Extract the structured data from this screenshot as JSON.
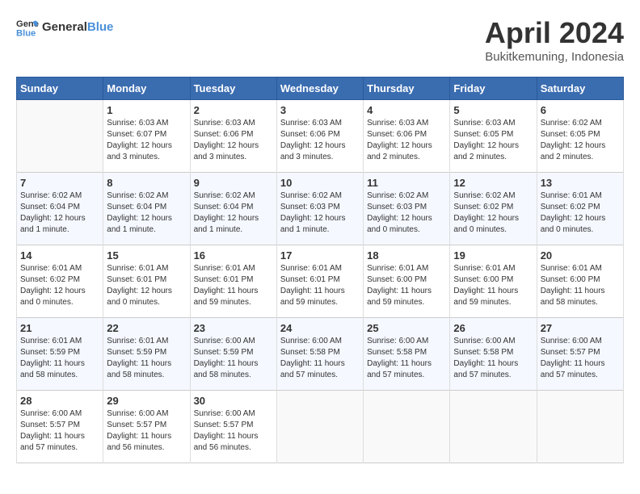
{
  "header": {
    "logo_general": "General",
    "logo_blue": "Blue",
    "month_title": "April 2024",
    "location": "Bukitkemuning, Indonesia"
  },
  "days_of_week": [
    "Sunday",
    "Monday",
    "Tuesday",
    "Wednesday",
    "Thursday",
    "Friday",
    "Saturday"
  ],
  "weeks": [
    [
      {
        "day": "",
        "info": ""
      },
      {
        "day": "1",
        "info": "Sunrise: 6:03 AM\nSunset: 6:07 PM\nDaylight: 12 hours\nand 3 minutes."
      },
      {
        "day": "2",
        "info": "Sunrise: 6:03 AM\nSunset: 6:06 PM\nDaylight: 12 hours\nand 3 minutes."
      },
      {
        "day": "3",
        "info": "Sunrise: 6:03 AM\nSunset: 6:06 PM\nDaylight: 12 hours\nand 3 minutes."
      },
      {
        "day": "4",
        "info": "Sunrise: 6:03 AM\nSunset: 6:06 PM\nDaylight: 12 hours\nand 2 minutes."
      },
      {
        "day": "5",
        "info": "Sunrise: 6:03 AM\nSunset: 6:05 PM\nDaylight: 12 hours\nand 2 minutes."
      },
      {
        "day": "6",
        "info": "Sunrise: 6:02 AM\nSunset: 6:05 PM\nDaylight: 12 hours\nand 2 minutes."
      }
    ],
    [
      {
        "day": "7",
        "info": "Sunrise: 6:02 AM\nSunset: 6:04 PM\nDaylight: 12 hours\nand 1 minute."
      },
      {
        "day": "8",
        "info": "Sunrise: 6:02 AM\nSunset: 6:04 PM\nDaylight: 12 hours\nand 1 minute."
      },
      {
        "day": "9",
        "info": "Sunrise: 6:02 AM\nSunset: 6:04 PM\nDaylight: 12 hours\nand 1 minute."
      },
      {
        "day": "10",
        "info": "Sunrise: 6:02 AM\nSunset: 6:03 PM\nDaylight: 12 hours\nand 1 minute."
      },
      {
        "day": "11",
        "info": "Sunrise: 6:02 AM\nSunset: 6:03 PM\nDaylight: 12 hours\nand 0 minutes."
      },
      {
        "day": "12",
        "info": "Sunrise: 6:02 AM\nSunset: 6:02 PM\nDaylight: 12 hours\nand 0 minutes."
      },
      {
        "day": "13",
        "info": "Sunrise: 6:01 AM\nSunset: 6:02 PM\nDaylight: 12 hours\nand 0 minutes."
      }
    ],
    [
      {
        "day": "14",
        "info": "Sunrise: 6:01 AM\nSunset: 6:02 PM\nDaylight: 12 hours\nand 0 minutes."
      },
      {
        "day": "15",
        "info": "Sunrise: 6:01 AM\nSunset: 6:01 PM\nDaylight: 12 hours\nand 0 minutes."
      },
      {
        "day": "16",
        "info": "Sunrise: 6:01 AM\nSunset: 6:01 PM\nDaylight: 11 hours\nand 59 minutes."
      },
      {
        "day": "17",
        "info": "Sunrise: 6:01 AM\nSunset: 6:01 PM\nDaylight: 11 hours\nand 59 minutes."
      },
      {
        "day": "18",
        "info": "Sunrise: 6:01 AM\nSunset: 6:00 PM\nDaylight: 11 hours\nand 59 minutes."
      },
      {
        "day": "19",
        "info": "Sunrise: 6:01 AM\nSunset: 6:00 PM\nDaylight: 11 hours\nand 59 minutes."
      },
      {
        "day": "20",
        "info": "Sunrise: 6:01 AM\nSunset: 6:00 PM\nDaylight: 11 hours\nand 58 minutes."
      }
    ],
    [
      {
        "day": "21",
        "info": "Sunrise: 6:01 AM\nSunset: 5:59 PM\nDaylight: 11 hours\nand 58 minutes."
      },
      {
        "day": "22",
        "info": "Sunrise: 6:01 AM\nSunset: 5:59 PM\nDaylight: 11 hours\nand 58 minutes."
      },
      {
        "day": "23",
        "info": "Sunrise: 6:00 AM\nSunset: 5:59 PM\nDaylight: 11 hours\nand 58 minutes."
      },
      {
        "day": "24",
        "info": "Sunrise: 6:00 AM\nSunset: 5:58 PM\nDaylight: 11 hours\nand 57 minutes."
      },
      {
        "day": "25",
        "info": "Sunrise: 6:00 AM\nSunset: 5:58 PM\nDaylight: 11 hours\nand 57 minutes."
      },
      {
        "day": "26",
        "info": "Sunrise: 6:00 AM\nSunset: 5:58 PM\nDaylight: 11 hours\nand 57 minutes."
      },
      {
        "day": "27",
        "info": "Sunrise: 6:00 AM\nSunset: 5:57 PM\nDaylight: 11 hours\nand 57 minutes."
      }
    ],
    [
      {
        "day": "28",
        "info": "Sunrise: 6:00 AM\nSunset: 5:57 PM\nDaylight: 11 hours\nand 57 minutes."
      },
      {
        "day": "29",
        "info": "Sunrise: 6:00 AM\nSunset: 5:57 PM\nDaylight: 11 hours\nand 56 minutes."
      },
      {
        "day": "30",
        "info": "Sunrise: 6:00 AM\nSunset: 5:57 PM\nDaylight: 11 hours\nand 56 minutes."
      },
      {
        "day": "",
        "info": ""
      },
      {
        "day": "",
        "info": ""
      },
      {
        "day": "",
        "info": ""
      },
      {
        "day": "",
        "info": ""
      }
    ]
  ]
}
